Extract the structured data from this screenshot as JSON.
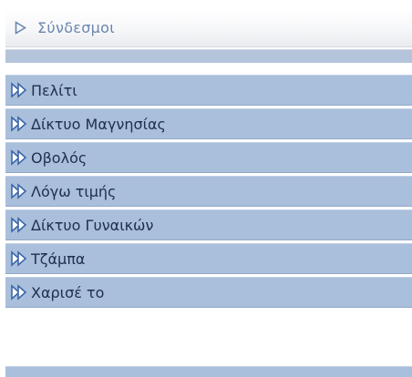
{
  "header": {
    "title": "Σύνδεσμοι",
    "icon": "triangle-outline-right-icon"
  },
  "menu": {
    "items": [
      {
        "label": "Πελίτι",
        "icon": "double-arrow-icon"
      },
      {
        "label": "Δίκτυο Μαγνησίας",
        "icon": "double-arrow-icon"
      },
      {
        "label": "Οβολός",
        "icon": "double-arrow-icon"
      },
      {
        "label": "Λόγω τιμής",
        "icon": "double-arrow-icon"
      },
      {
        "label": "Δίκτυο Γυναικών",
        "icon": "double-arrow-icon"
      },
      {
        "label": "Τζάμπα",
        "icon": "double-arrow-icon"
      },
      {
        "label": "Χαρισέ το",
        "icon": "double-arrow-icon"
      }
    ]
  },
  "colors": {
    "header_title": "#6b86ad",
    "item_background": "#a9bfdb",
    "item_text": "#1e2f4f",
    "arrow_fill": "#ffffff",
    "arrow_outline": "#3c66a8"
  }
}
